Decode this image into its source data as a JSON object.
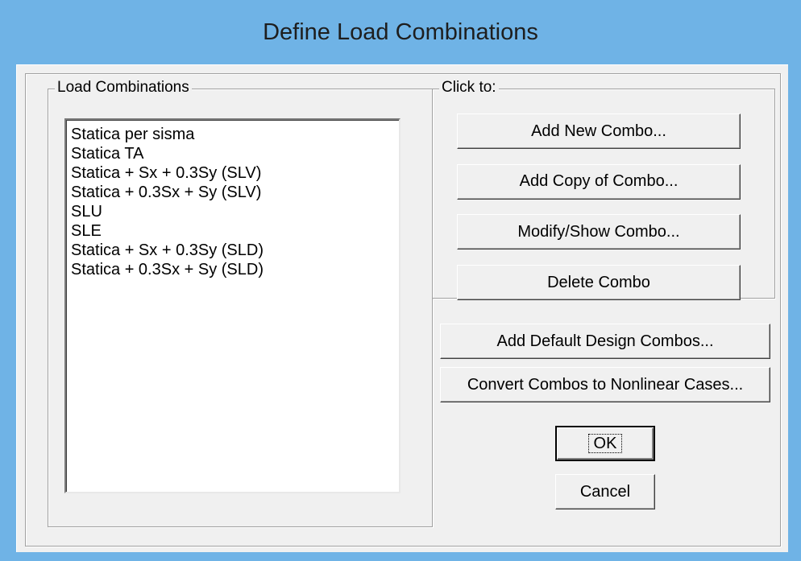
{
  "window": {
    "title": "Define Load Combinations"
  },
  "load_combinations": {
    "group_label": "Load Combinations",
    "items": [
      "Statica per sisma",
      "Statica TA",
      "Statica + Sx + 0.3Sy (SLV)",
      "Statica + 0.3Sx + Sy (SLV)",
      "SLU",
      "SLE",
      "Statica + Sx + 0.3Sy (SLD)",
      "Statica + 0.3Sx + Sy (SLD)"
    ]
  },
  "click_to": {
    "group_label": "Click to:",
    "add_new": "Add New Combo...",
    "add_copy": "Add Copy of Combo...",
    "modify_show": "Modify/Show Combo...",
    "delete": "Delete Combo"
  },
  "actions": {
    "add_default_design": "Add Default Design Combos...",
    "convert_nonlinear": "Convert Combos to Nonlinear Cases...",
    "ok": "OK",
    "cancel": "Cancel"
  },
  "colors": {
    "title_bar": "#6fb3e6",
    "dialog_face": "#f0f0f0"
  }
}
